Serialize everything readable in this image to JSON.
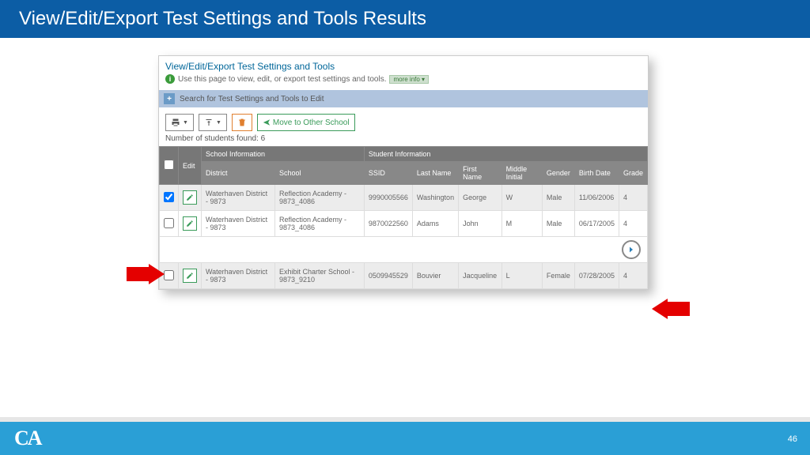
{
  "slide": {
    "title": "View/Edit/Export Test Settings and Tools Results",
    "page_number": "46",
    "logo_text": "CA"
  },
  "panel": {
    "header": "View/Edit/Export Test Settings and Tools",
    "help_text": "Use this page to view, edit, or export test settings and tools.",
    "more_info": "more info ▾",
    "search_label": "Search for Test Settings and Tools to Edit",
    "toolbar": {
      "move_label": "Move to Other School"
    },
    "count_label": "Number of students found: 6",
    "columns": {
      "edit": "Edit",
      "school_info": "School Information",
      "student_info": "Student Information",
      "district": "District",
      "school": "School",
      "ssid": "SSID",
      "last_name": "Last Name",
      "first_name": "First Name",
      "middle_initial": "Middle Initial",
      "gender": "Gender",
      "birth_date": "Birth Date",
      "grade": "Grade"
    },
    "rows": [
      {
        "checked": true,
        "district": "Waterhaven District - 9873",
        "school": "Reflection Academy - 9873_4086",
        "ssid": "9990005566",
        "last": "Washington",
        "first": "George",
        "mi": "W",
        "gender": "Male",
        "dob": "11/06/2006",
        "grade": "4"
      },
      {
        "checked": false,
        "district": "Waterhaven District - 9873",
        "school": "Reflection Academy - 9873_4086",
        "ssid": "9870022560",
        "last": "Adams",
        "first": "John",
        "mi": "M",
        "gender": "Male",
        "dob": "06/17/2005",
        "grade": "4"
      },
      {
        "checked": false,
        "district": "Waterhaven District - 9873",
        "school": "Exhibit Charter School - 9873_9210",
        "ssid": "0509945529",
        "last": "Bouvier",
        "first": "Jacqueline",
        "mi": "L",
        "gender": "Female",
        "dob": "07/28/2005",
        "grade": "4"
      }
    ]
  }
}
